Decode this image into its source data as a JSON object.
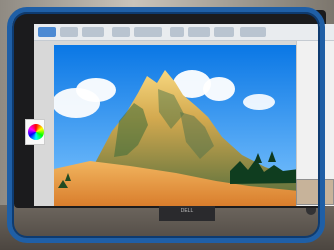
{
  "scene": {
    "monitor_brand": "DELL"
  }
}
